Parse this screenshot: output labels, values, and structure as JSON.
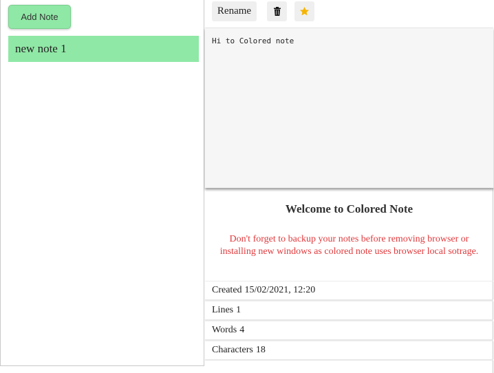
{
  "sidebar": {
    "add_note_label": "Add Note",
    "notes": [
      {
        "title": "new note 1"
      }
    ],
    "note_color": "#90e8a6"
  },
  "toolbar": {
    "rename_label": "Rename",
    "delete_icon": "trash-icon",
    "favorite_icon": "star-icon",
    "star_color": "#f5b400"
  },
  "editor": {
    "content": "Hi to Colored note"
  },
  "info": {
    "title": "Welcome to Colored Note",
    "warning": "Don't forget to backup your notes before removing browser or installing new windows as colored note uses browser local sotrage.",
    "warning_color": "#e0393c"
  },
  "stats": {
    "created_label": "Created",
    "created_value": "15/02/2021, 12:20",
    "lines_label": "Lines",
    "lines_value": "1",
    "words_label": "Words",
    "words_value": "4",
    "characters_label": "Characters",
    "characters_value": "18"
  }
}
